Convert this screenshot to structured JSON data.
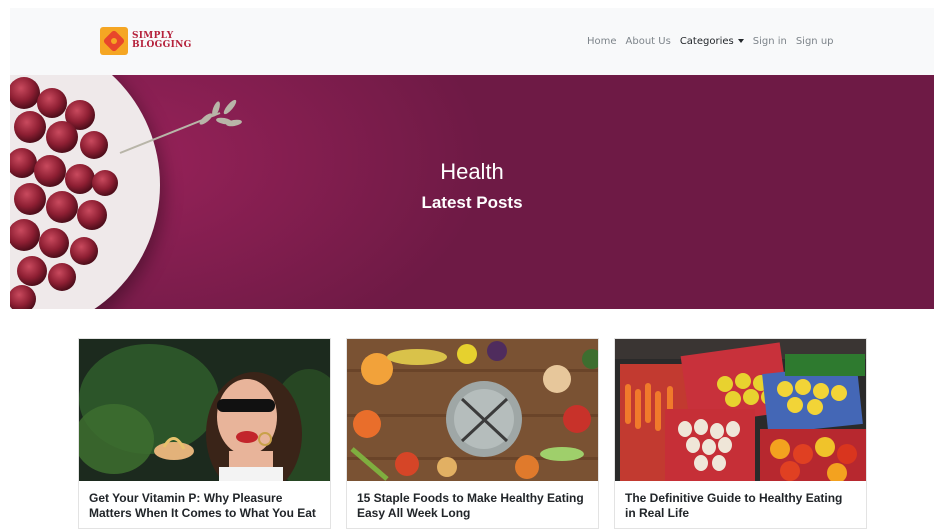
{
  "brand": {
    "line1": "SIMPLY",
    "line2": "BLOGGING",
    "logo_icon": "puzzle-logo-icon"
  },
  "nav": {
    "items": [
      {
        "label": "Home",
        "active": false
      },
      {
        "label": "About Us",
        "active": false
      },
      {
        "label": "Categories",
        "active": true,
        "dropdown": true
      },
      {
        "label": "Sign in",
        "active": false
      },
      {
        "label": "Sign up",
        "active": false
      }
    ]
  },
  "hero": {
    "title": "Health",
    "subtitle": "Latest Posts",
    "background_color": "#6e1a45"
  },
  "posts": [
    {
      "title": "Get Your Vitamin P: Why Pleasure Matters When It Comes to What You Eat",
      "image": "woman-eating-pasta-photo"
    },
    {
      "title": "15 Staple Foods to Make Healthy Eating Easy All Week Long",
      "image": "vegetables-around-plate-photo"
    },
    {
      "title": "The Definitive Guide to Healthy Eating in Real Life",
      "image": "market-produce-baskets-photo"
    }
  ]
}
